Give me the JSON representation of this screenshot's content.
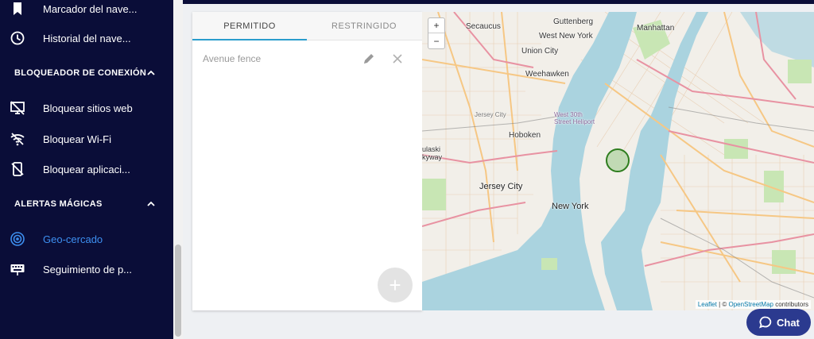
{
  "sidebar": {
    "items_top": [
      {
        "label": "Marcador del nave...",
        "icon": "bookmark-icon"
      },
      {
        "label": "Historial del nave...",
        "icon": "clock-icon"
      }
    ],
    "sections": [
      {
        "title": "BLOQUEADOR DE CONEXIÓN",
        "items": [
          {
            "label": "Bloquear sitios web",
            "icon": "monitor-off-icon"
          },
          {
            "label": "Bloquear Wi-Fi",
            "icon": "wifi-off-icon"
          },
          {
            "label": "Bloquear aplicaci...",
            "icon": "phone-off-icon"
          }
        ]
      },
      {
        "title": "ALERTAS MÁGICAS",
        "items": [
          {
            "label": "Geo-cercado",
            "icon": "target-icon",
            "active": true
          },
          {
            "label": "Seguimiento de p...",
            "icon": "keyboard-icon"
          }
        ]
      }
    ]
  },
  "panel": {
    "tabs": [
      {
        "label": "PERMITIDO",
        "active": true
      },
      {
        "label": "RESTRINGIDO",
        "active": false
      }
    ],
    "fences": [
      {
        "name": "Avenue fence"
      }
    ],
    "add_label": "+"
  },
  "map": {
    "zoom_in": "+",
    "zoom_out": "−",
    "labels": [
      "Secaucus",
      "Guttenberg",
      "West New York",
      "Manhattan",
      "Union City",
      "Weehawken",
      "Jersey City",
      "West 30th Street Heliport",
      "Hoboken",
      "ulaski kyway",
      "Jersey City",
      "New York"
    ],
    "attribution": {
      "leaflet": "Leaflet",
      "sep": " | © ",
      "osm": "OpenStreetMap",
      "rest": " contributors"
    },
    "colors": {
      "water": "#aad3df",
      "land": "#f2efe9",
      "park": "#c8e6b4",
      "road_major": "#f6c784",
      "road_pink": "#e892a2",
      "fence": "#2e7d1e"
    }
  },
  "chat": {
    "label": "Chat"
  },
  "colors": {
    "sidebar_bg": "#0a0d38",
    "active": "#3d8ff0",
    "tab_underline": "#2a9dcc",
    "chat_bg": "#2b3a8f"
  }
}
